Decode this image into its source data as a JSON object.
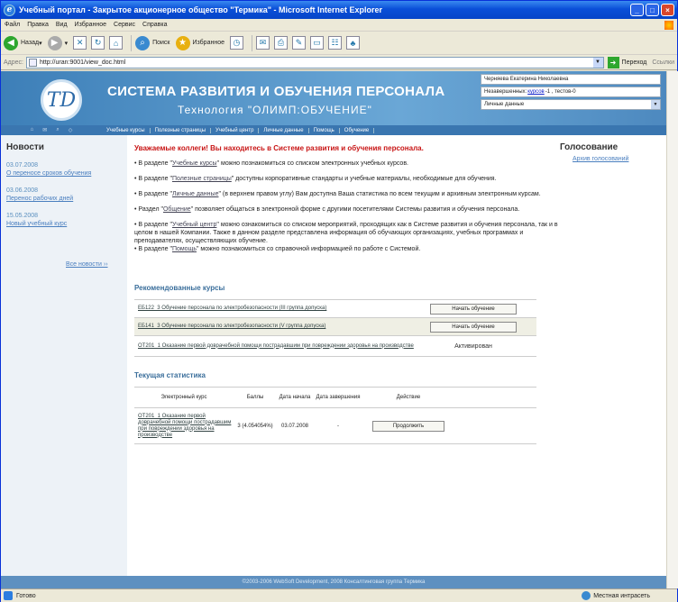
{
  "window": {
    "title": "Учебный портал - Закрытое акционерное общество \"Термика\" - Microsoft Internet Explorer",
    "min": "_",
    "max": "□",
    "close": "×"
  },
  "menubar": [
    "Файл",
    "Правка",
    "Вид",
    "Избранное",
    "Сервис",
    "Справка"
  ],
  "toolbar": {
    "back": "Назад",
    "search": "Поиск",
    "favorites": "Избранное"
  },
  "address": {
    "label": "Адрес:",
    "url": "http://uran:9001/view_doc.html",
    "go": "Переход",
    "links": "Ссылки"
  },
  "site": {
    "title": "СИСТЕМА РАЗВИТИЯ И ОБУЧЕНИЯ ПЕРСОНАЛА",
    "subtitle": "Технология \"ОЛИМП:ОБУЧЕНИЕ\"",
    "logo_text": "TD",
    "user_name": "Черняева Екатерина Николаевна",
    "user_stats_prefix": "Незавершенных:",
    "user_stats_link": "курсов",
    "user_stats_suffix": "-1 , тестов-0",
    "user_select": "Личные данные"
  },
  "nav": [
    "Учебные курсы",
    "Полезные страницы",
    "Учебный центр",
    "Личные данные",
    "Помощь",
    "Обучение"
  ],
  "news": {
    "heading": "Новости",
    "items": [
      {
        "date": "03.07.2008",
        "text": "О переносе сроков обучения"
      },
      {
        "date": "03.06.2008",
        "text": "Перенос рабочих дней"
      },
      {
        "date": "15.05.2008",
        "text": "Новый учебный курс"
      }
    ],
    "all": "Все новости ››"
  },
  "main": {
    "welcome": "Уважаемые коллеги! Вы находитесь в Системе развития и обучения персонала.",
    "p1": {
      "a": "• В разделе \"",
      "link": "Учебные курсы",
      "b": "\" можно познакомиться со списком электронных учебных курсов."
    },
    "p2": {
      "a": "• В разделе \"",
      "link": "Полезные страницы",
      "b": "\" доступны корпоративные стандарты и учебные материалы, необходимые для обучения."
    },
    "p3": {
      "a": "• В разделе \"",
      "link": "Личные данные",
      "b": "\" (в верхнем правом углу) Вам доступна Ваша статистика по всем текущим и архивным электронным курсам."
    },
    "p4": {
      "a": "• Раздел \"",
      "link": "Общение",
      "b": "\" позволяет общаться в электронной форме с другими посетителями Системы развития и обучения персонала."
    },
    "p5": {
      "a": "• В разделе \"",
      "link": "Учебный центр",
      "b": "\" можно ознакомиться со списком мероприятий, проходящих как в Системе развития и обучения персонала, так и в целом в нашей Компании. Также в данном разделе представлена информация об обучающих организациях, учебных программах и преподавателях, осуществляющих обучение."
    },
    "p6": {
      "a": "• В разделе \"",
      "link": "Помощь",
      "b": "\" можно познакомиться со справочной информацией по работе с Системой."
    }
  },
  "recommended": {
    "heading": "Рекомендованные курсы",
    "rows": [
      {
        "name": "ЕБ122_3 Обучение персонала по электробезопасности (III группа допуска)",
        "action": "Начать обучение"
      },
      {
        "name": "ЕБ141_3 Обучение персонала по электробезопасности (V группа допуска)",
        "action": "Начать обучение"
      },
      {
        "name": "ОТ201_1 Оказание первой доврачебной помощи пострадавшим при повреждении здоровья на производстве",
        "action": "Активирован"
      }
    ]
  },
  "stats": {
    "heading": "Текущая статистика",
    "headers": [
      "Электронный курс",
      "Баллы",
      "Дата начала",
      "Дата завершения",
      "Действие"
    ],
    "row": {
      "course": "ОТ201_1 Оказание первой доврачебной помощи пострадавшим при повреждении здоровья на производстве",
      "score": "3 (4.054054%)",
      "start": "03.07.2008",
      "end": "-",
      "action": "Продолжить"
    }
  },
  "voting": {
    "heading": "Голосование",
    "archive": "Архив голосований"
  },
  "footer": "©2003-2006 WebSoft Development, 2008 Консалтинговая группа Термика",
  "status": {
    "text": "Готово",
    "zone": "Местная интрасеть"
  }
}
